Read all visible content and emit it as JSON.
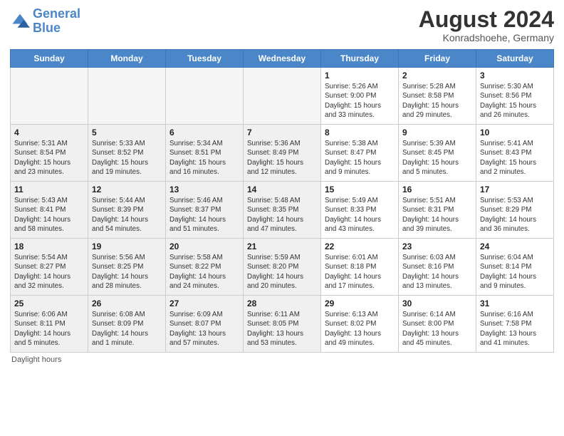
{
  "header": {
    "logo_line1": "General",
    "logo_line2": "Blue",
    "month_year": "August 2024",
    "location": "Konradshoehe, Germany"
  },
  "days_of_week": [
    "Sunday",
    "Monday",
    "Tuesday",
    "Wednesday",
    "Thursday",
    "Friday",
    "Saturday"
  ],
  "weeks": [
    [
      {
        "day": "",
        "info": "",
        "shaded": true
      },
      {
        "day": "",
        "info": "",
        "shaded": true
      },
      {
        "day": "",
        "info": "",
        "shaded": true
      },
      {
        "day": "",
        "info": "",
        "shaded": true
      },
      {
        "day": "1",
        "info": "Sunrise: 5:26 AM\nSunset: 9:00 PM\nDaylight: 15 hours\nand 33 minutes.",
        "shaded": false
      },
      {
        "day": "2",
        "info": "Sunrise: 5:28 AM\nSunset: 8:58 PM\nDaylight: 15 hours\nand 29 minutes.",
        "shaded": false
      },
      {
        "day": "3",
        "info": "Sunrise: 5:30 AM\nSunset: 8:56 PM\nDaylight: 15 hours\nand 26 minutes.",
        "shaded": false
      }
    ],
    [
      {
        "day": "4",
        "info": "Sunrise: 5:31 AM\nSunset: 8:54 PM\nDaylight: 15 hours\nand 23 minutes.",
        "shaded": true
      },
      {
        "day": "5",
        "info": "Sunrise: 5:33 AM\nSunset: 8:52 PM\nDaylight: 15 hours\nand 19 minutes.",
        "shaded": true
      },
      {
        "day": "6",
        "info": "Sunrise: 5:34 AM\nSunset: 8:51 PM\nDaylight: 15 hours\nand 16 minutes.",
        "shaded": true
      },
      {
        "day": "7",
        "info": "Sunrise: 5:36 AM\nSunset: 8:49 PM\nDaylight: 15 hours\nand 12 minutes.",
        "shaded": true
      },
      {
        "day": "8",
        "info": "Sunrise: 5:38 AM\nSunset: 8:47 PM\nDaylight: 15 hours\nand 9 minutes.",
        "shaded": false
      },
      {
        "day": "9",
        "info": "Sunrise: 5:39 AM\nSunset: 8:45 PM\nDaylight: 15 hours\nand 5 minutes.",
        "shaded": false
      },
      {
        "day": "10",
        "info": "Sunrise: 5:41 AM\nSunset: 8:43 PM\nDaylight: 15 hours\nand 2 minutes.",
        "shaded": false
      }
    ],
    [
      {
        "day": "11",
        "info": "Sunrise: 5:43 AM\nSunset: 8:41 PM\nDaylight: 14 hours\nand 58 minutes.",
        "shaded": true
      },
      {
        "day": "12",
        "info": "Sunrise: 5:44 AM\nSunset: 8:39 PM\nDaylight: 14 hours\nand 54 minutes.",
        "shaded": true
      },
      {
        "day": "13",
        "info": "Sunrise: 5:46 AM\nSunset: 8:37 PM\nDaylight: 14 hours\nand 51 minutes.",
        "shaded": true
      },
      {
        "day": "14",
        "info": "Sunrise: 5:48 AM\nSunset: 8:35 PM\nDaylight: 14 hours\nand 47 minutes.",
        "shaded": true
      },
      {
        "day": "15",
        "info": "Sunrise: 5:49 AM\nSunset: 8:33 PM\nDaylight: 14 hours\nand 43 minutes.",
        "shaded": false
      },
      {
        "day": "16",
        "info": "Sunrise: 5:51 AM\nSunset: 8:31 PM\nDaylight: 14 hours\nand 39 minutes.",
        "shaded": false
      },
      {
        "day": "17",
        "info": "Sunrise: 5:53 AM\nSunset: 8:29 PM\nDaylight: 14 hours\nand 36 minutes.",
        "shaded": false
      }
    ],
    [
      {
        "day": "18",
        "info": "Sunrise: 5:54 AM\nSunset: 8:27 PM\nDaylight: 14 hours\nand 32 minutes.",
        "shaded": true
      },
      {
        "day": "19",
        "info": "Sunrise: 5:56 AM\nSunset: 8:25 PM\nDaylight: 14 hours\nand 28 minutes.",
        "shaded": true
      },
      {
        "day": "20",
        "info": "Sunrise: 5:58 AM\nSunset: 8:22 PM\nDaylight: 14 hours\nand 24 minutes.",
        "shaded": true
      },
      {
        "day": "21",
        "info": "Sunrise: 5:59 AM\nSunset: 8:20 PM\nDaylight: 14 hours\nand 20 minutes.",
        "shaded": true
      },
      {
        "day": "22",
        "info": "Sunrise: 6:01 AM\nSunset: 8:18 PM\nDaylight: 14 hours\nand 17 minutes.",
        "shaded": false
      },
      {
        "day": "23",
        "info": "Sunrise: 6:03 AM\nSunset: 8:16 PM\nDaylight: 14 hours\nand 13 minutes.",
        "shaded": false
      },
      {
        "day": "24",
        "info": "Sunrise: 6:04 AM\nSunset: 8:14 PM\nDaylight: 14 hours\nand 9 minutes.",
        "shaded": false
      }
    ],
    [
      {
        "day": "25",
        "info": "Sunrise: 6:06 AM\nSunset: 8:11 PM\nDaylight: 14 hours\nand 5 minutes.",
        "shaded": true
      },
      {
        "day": "26",
        "info": "Sunrise: 6:08 AM\nSunset: 8:09 PM\nDaylight: 14 hours\nand 1 minute.",
        "shaded": true
      },
      {
        "day": "27",
        "info": "Sunrise: 6:09 AM\nSunset: 8:07 PM\nDaylight: 13 hours\nand 57 minutes.",
        "shaded": true
      },
      {
        "day": "28",
        "info": "Sunrise: 6:11 AM\nSunset: 8:05 PM\nDaylight: 13 hours\nand 53 minutes.",
        "shaded": true
      },
      {
        "day": "29",
        "info": "Sunrise: 6:13 AM\nSunset: 8:02 PM\nDaylight: 13 hours\nand 49 minutes.",
        "shaded": false
      },
      {
        "day": "30",
        "info": "Sunrise: 6:14 AM\nSunset: 8:00 PM\nDaylight: 13 hours\nand 45 minutes.",
        "shaded": false
      },
      {
        "day": "31",
        "info": "Sunrise: 6:16 AM\nSunset: 7:58 PM\nDaylight: 13 hours\nand 41 minutes.",
        "shaded": false
      }
    ]
  ],
  "footer": {
    "note": "Daylight hours"
  }
}
